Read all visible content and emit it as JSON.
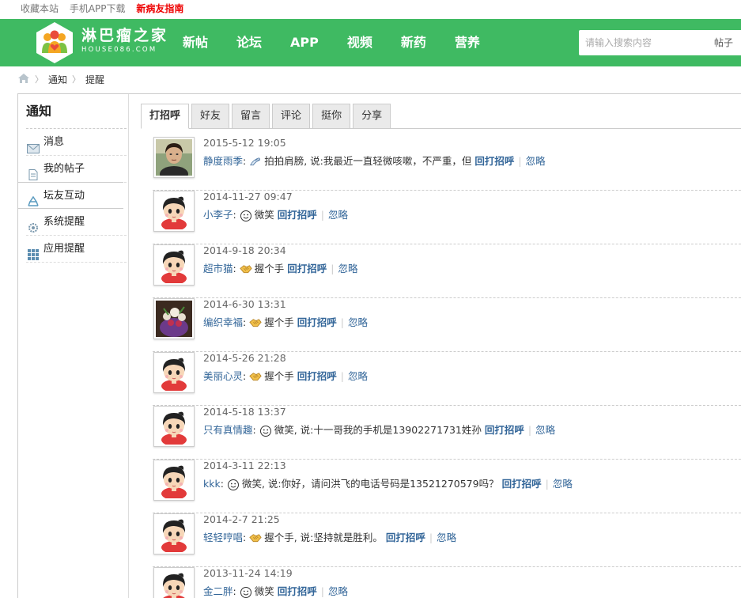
{
  "topbar": {
    "bookmark": "收藏本站",
    "app_download": "手机APP下载",
    "guide": "新病友指南"
  },
  "header": {
    "logo_cn": "淋巴瘤之家",
    "logo_en": "HOUSE086.COM",
    "nav": [
      "新帖",
      "论坛",
      "APP",
      "视频",
      "新药",
      "营养"
    ],
    "search_placeholder": "请输入搜索内容",
    "search_scope": "帖子",
    "color": "#3fba62"
  },
  "breadcrumb": {
    "home_icon": "home-icon",
    "items": [
      "通知",
      "提醒"
    ]
  },
  "sidebar": {
    "title": "通知",
    "items": [
      {
        "label": "消息",
        "icon": "envelope-icon"
      },
      {
        "label": "我的帖子",
        "icon": "document-icon"
      },
      {
        "label": "坛友互动",
        "icon": "recycle-icon"
      },
      {
        "label": "系统提醒",
        "icon": "gear-icon"
      },
      {
        "label": "应用提醒",
        "icon": "grid-icon"
      }
    ],
    "active_index": 2
  },
  "tabs": {
    "items": [
      "打招呼",
      "好友",
      "留言",
      "评论",
      "挺你",
      "分享"
    ],
    "active_index": 0
  },
  "notifications": [
    {
      "time": "2015-5-12 19:05",
      "user": "静度雨季",
      "emote": "pat-icon",
      "text": "拍拍肩膀, 说:我最近一直轻微咳嗽，不严重，但",
      "reply": "回打招呼",
      "ignore": "忽略",
      "avatar": "photo-woman"
    },
    {
      "time": "2014-11-27 09:47",
      "user": "小李子",
      "emote": "smile-icon",
      "text": "微笑",
      "reply": "回打招呼",
      "ignore": "忽略",
      "avatar": "default"
    },
    {
      "time": "2014-9-18 20:34",
      "user": "超市猫",
      "emote": "handshake-icon",
      "text": "握个手",
      "reply": "回打招呼",
      "ignore": "忽略",
      "avatar": "default"
    },
    {
      "time": "2014-6-30 13:31",
      "user": "编织幸福",
      "emote": "handshake-icon",
      "text": "握个手",
      "reply": "回打招呼",
      "ignore": "忽略",
      "avatar": "photo-flowers"
    },
    {
      "time": "2014-5-26 21:28",
      "user": "美丽心灵",
      "emote": "handshake-icon",
      "text": "握个手",
      "reply": "回打招呼",
      "ignore": "忽略",
      "avatar": "default"
    },
    {
      "time": "2014-5-18 13:37",
      "user": "只有真情趣",
      "emote": "smile-icon",
      "text": "微笑, 说:十一哥我的手机是13902271731姓孙",
      "reply": "回打招呼",
      "ignore": "忽略",
      "avatar": "default"
    },
    {
      "time": "2014-3-11 22:13",
      "user": "kkk",
      "emote": "smile-icon",
      "text": "微笑, 说:你好，请问洪飞的电话号码是13521270579吗？",
      "reply": "回打招呼",
      "ignore": "忽略",
      "avatar": "default"
    },
    {
      "time": "2014-2-7 21:25",
      "user": "轻轻哼唱",
      "emote": "handshake-icon",
      "text": "握个手, 说:坚持就是胜利。",
      "reply": "回打招呼",
      "ignore": "忽略",
      "avatar": "default"
    },
    {
      "time": "2013-11-24 14:19",
      "user": "金二胖",
      "emote": "smile-icon",
      "text": "微笑",
      "reply": "回打招呼",
      "ignore": "忽略",
      "avatar": "default"
    }
  ]
}
